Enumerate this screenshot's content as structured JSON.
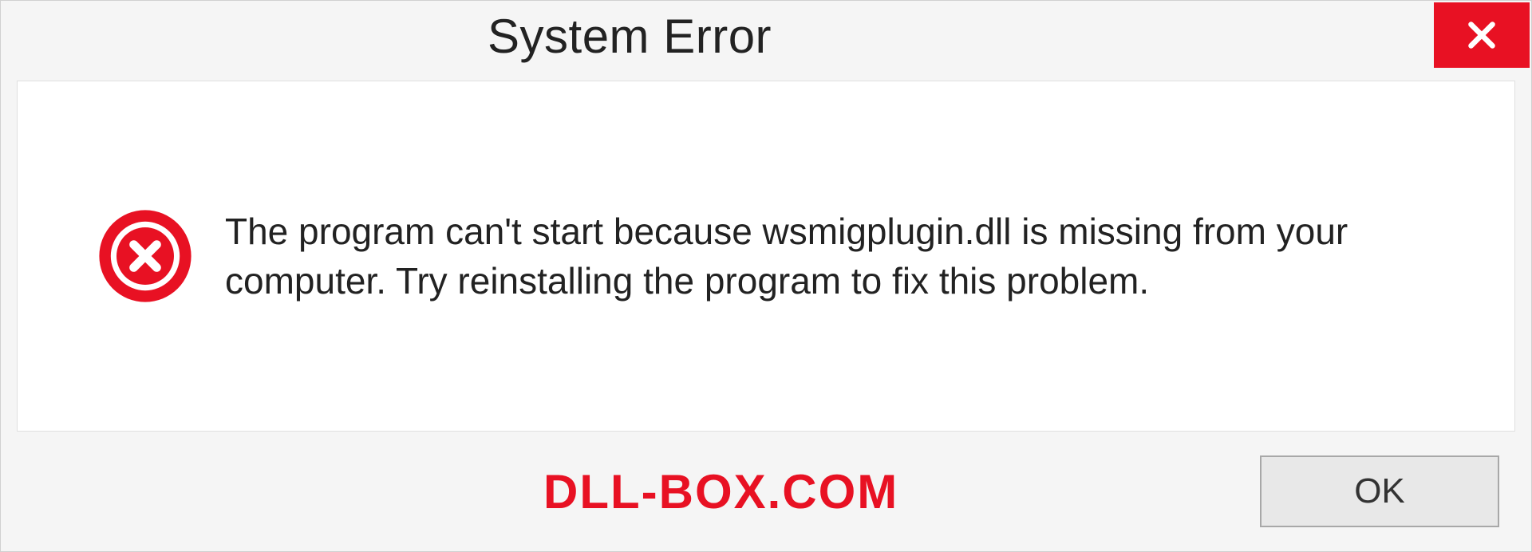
{
  "titlebar": {
    "title": "System Error"
  },
  "content": {
    "message": "The program can't start because wsmigplugin.dll is missing from your computer. Try reinstalling the program to fix this problem."
  },
  "footer": {
    "watermark": "DLL-BOX.COM",
    "ok_label": "OK"
  },
  "colors": {
    "error_red": "#e81123",
    "close_bg": "#e81123"
  }
}
